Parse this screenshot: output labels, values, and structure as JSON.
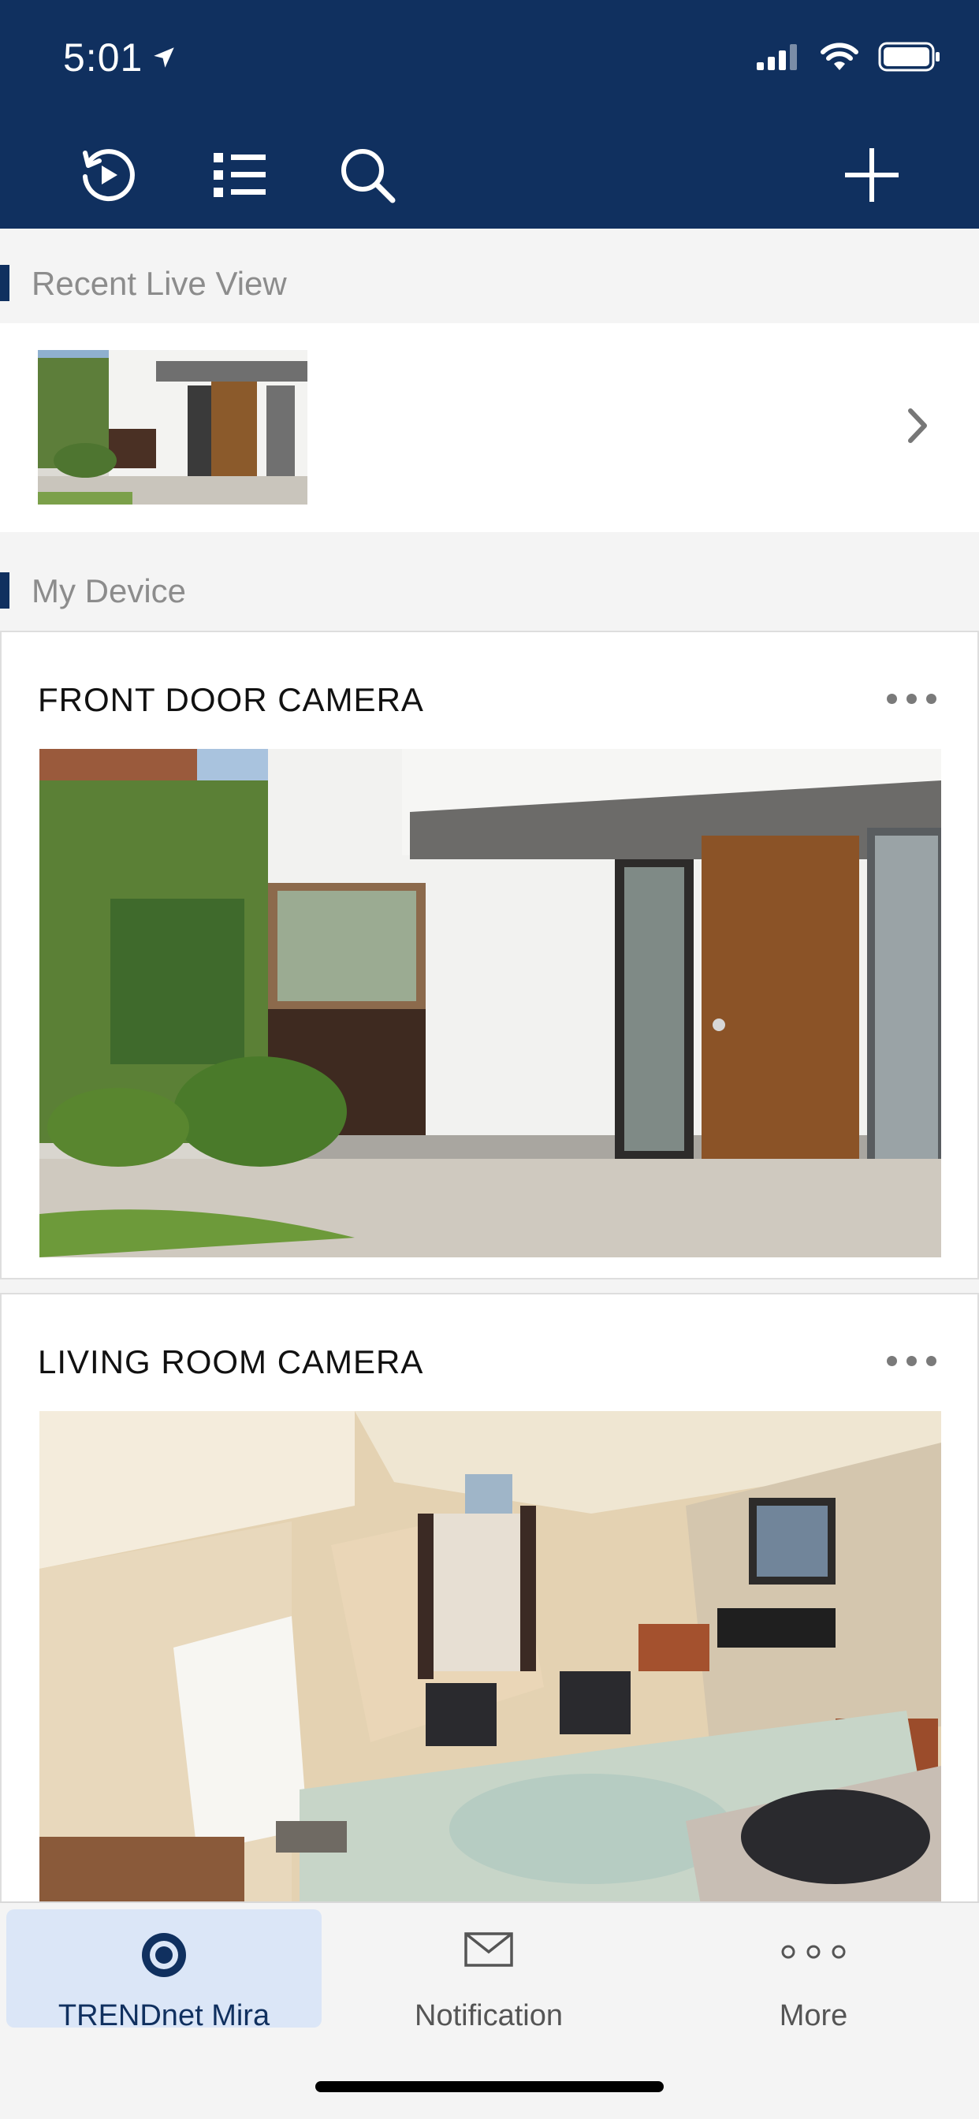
{
  "status_bar": {
    "time": "5:01"
  },
  "toolbar": {
    "playback_icon": "playback-icon",
    "list_icon": "list-icon",
    "search_icon": "search-icon",
    "add_icon": "add-icon"
  },
  "sections": {
    "recent_live_view": "Recent Live View",
    "my_device": "My Device"
  },
  "devices": [
    {
      "name": "FRONT DOOR CAMERA"
    },
    {
      "name": "LIVING ROOM CAMERA"
    }
  ],
  "tabs": [
    {
      "label": "TRENDnet Mira",
      "icon": "camera-icon",
      "active": true
    },
    {
      "label": "Notification",
      "icon": "envelope-icon",
      "active": false
    },
    {
      "label": "More",
      "icon": "more-dots-icon",
      "active": false
    }
  ],
  "colors": {
    "header": "#10305f",
    "active_tab_bg": "#dbe6f7"
  }
}
